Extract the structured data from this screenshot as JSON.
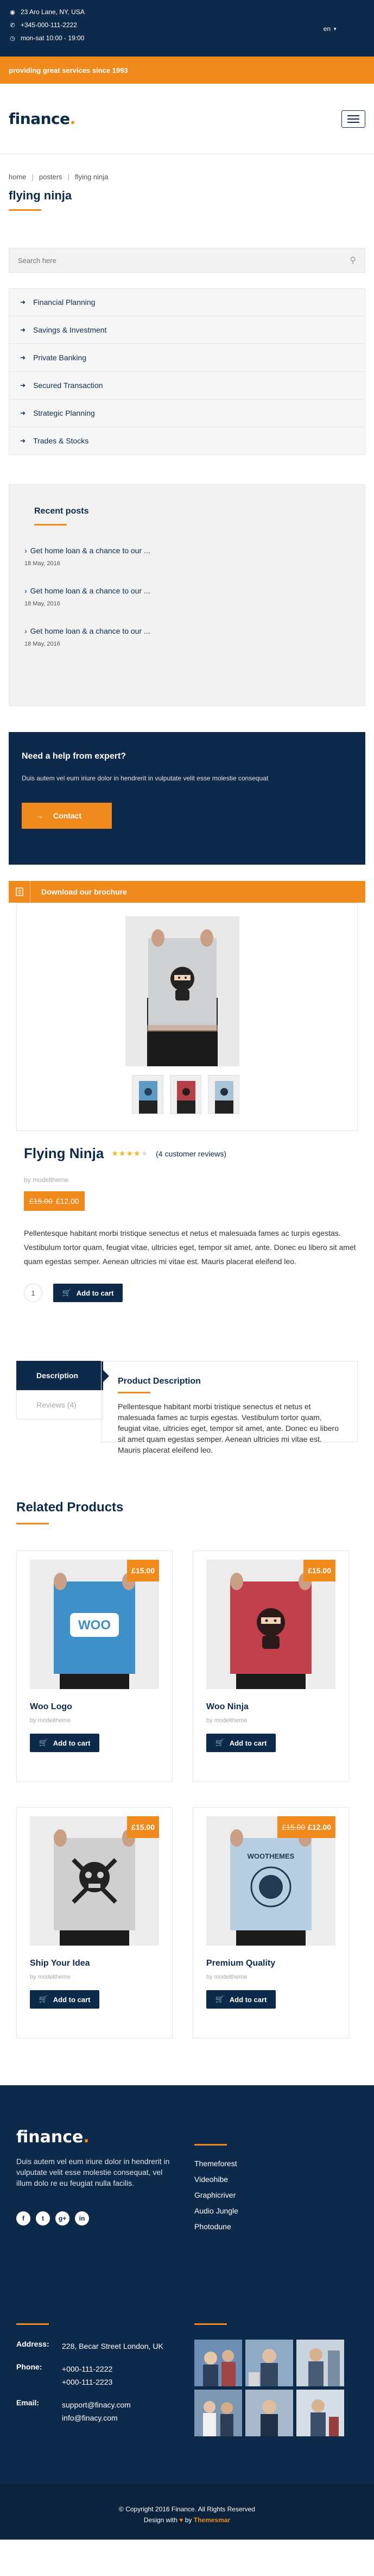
{
  "topbar": {
    "address": "23 Aro Lane, NY, USA",
    "phone": "+345-000-111-2222",
    "hours": "mon-sat 10:00 - 19:00",
    "language": "en",
    "icons": [
      "location-icon",
      "phone-icon",
      "clock-icon"
    ]
  },
  "promo": {
    "text": "providing great services since 1993"
  },
  "header": {
    "logo": "finance",
    "menu_icon": "hamburger-icon"
  },
  "breadcrumb": [
    "home",
    "posters",
    "flying ninja"
  ],
  "page": {
    "title": "flying ninja"
  },
  "search": {
    "placeholder": "Search here"
  },
  "categories": [
    "Financial Planning",
    "Savings & Investment",
    "Private Banking",
    "Secured Transaction",
    "Strategic Planning",
    "Trades & Stocks"
  ],
  "recent_posts": {
    "title": "Recent posts",
    "posts": [
      {
        "title": "Get home loan & a chance to our ...",
        "date": "18 May, 2016"
      },
      {
        "title": "Get home loan & a chance to our ...",
        "date": "18 May, 2016"
      },
      {
        "title": "Get home loan & a chance to our ...",
        "date": "18 May, 2016"
      }
    ]
  },
  "help": {
    "title": "Need a help from expert?",
    "text": "Duis autem vel eum iriure dolor in hendrerit in vulputate velit esse molestie consequat",
    "button": "Contact"
  },
  "brochure": {
    "label": "Download our brochure"
  },
  "product": {
    "name": "Flying Ninja",
    "rating": 4,
    "reviews": "(4 customer reviews)",
    "by": "by modeltheme",
    "old_price": "£15.00",
    "price": "£12.00",
    "description": "Pellentesque habitant morbi tristique senectus et netus et malesuada fames ac turpis egestas. Vestibulum tortor quam, feugiat vitae, ultricies eget, tempor sit amet, ante. Donec eu libero sit amet quam egestas semper. Aenean ultricies mi vitae est. Mauris placerat eleifend leo.",
    "qty": "1",
    "add_to_cart": "Add to cart"
  },
  "tabs": {
    "items": [
      "Description",
      "Reviews (4)"
    ],
    "panel_title": "Product Description",
    "panel_text": "Pellentesque habitant morbi tristique senectus et netus et malesuada fames ac turpis egestas. Vestibulum tortor quam, feugiat vitae, ultricies eget, tempor sit amet, ante. Donec eu libero sit amet quam egestas semper. Aenean ultricies mi vitae est. Mauris placerat eleifend leo."
  },
  "related": {
    "title": "Related Products",
    "products": [
      {
        "name": "Woo Logo",
        "by": "by modeltheme",
        "old": "",
        "price": "£15.00",
        "button": "Add to cart",
        "poster_text": "WOO"
      },
      {
        "name": "Woo Ninja",
        "by": "by modeltheme",
        "old": "",
        "price": "£15.00",
        "button": "Add to cart",
        "poster_text": ""
      },
      {
        "name": "Ship Your Idea",
        "by": "by modeltheme",
        "old": "",
        "price": "£15.00",
        "button": "Add to cart",
        "poster_text": ""
      },
      {
        "name": "Premium Quality",
        "by": "by modeltheme",
        "old": "£15.00",
        "price": "£12.00",
        "button": "Add to cart",
        "poster_text": "WOOTHEMES"
      }
    ]
  },
  "footer": {
    "logo": "finance",
    "about": "Duis autem vel eum iriure dolor in hendrerit in vulputate velit esse molestie consequat, vel illum dolo re eu feugiat nulla facilis.",
    "social": [
      "f",
      "t",
      "g+",
      "in"
    ],
    "links": [
      "Themeforest",
      "Videohibe",
      "Graphicriver",
      "Audio Jungle",
      "Photodune"
    ],
    "contact": {
      "address_label": "Address:",
      "address": "228, Becar Street London, UK",
      "phone_label": "Phone:",
      "phones": [
        "+000-111-2222",
        "+000-111-2223"
      ],
      "email_label": "Email:",
      "emails": [
        "support@finacy.com",
        "info@finacy.com"
      ]
    }
  },
  "copyright": {
    "line1": "© Copyright 2016 Finance. All Rights Reserved",
    "line2_prefix": "Design with",
    "line2_by": "by",
    "line2_author": "Themesmar"
  },
  "colors": {
    "navy": "#0e2a4a",
    "orange": "#f08a1c"
  }
}
